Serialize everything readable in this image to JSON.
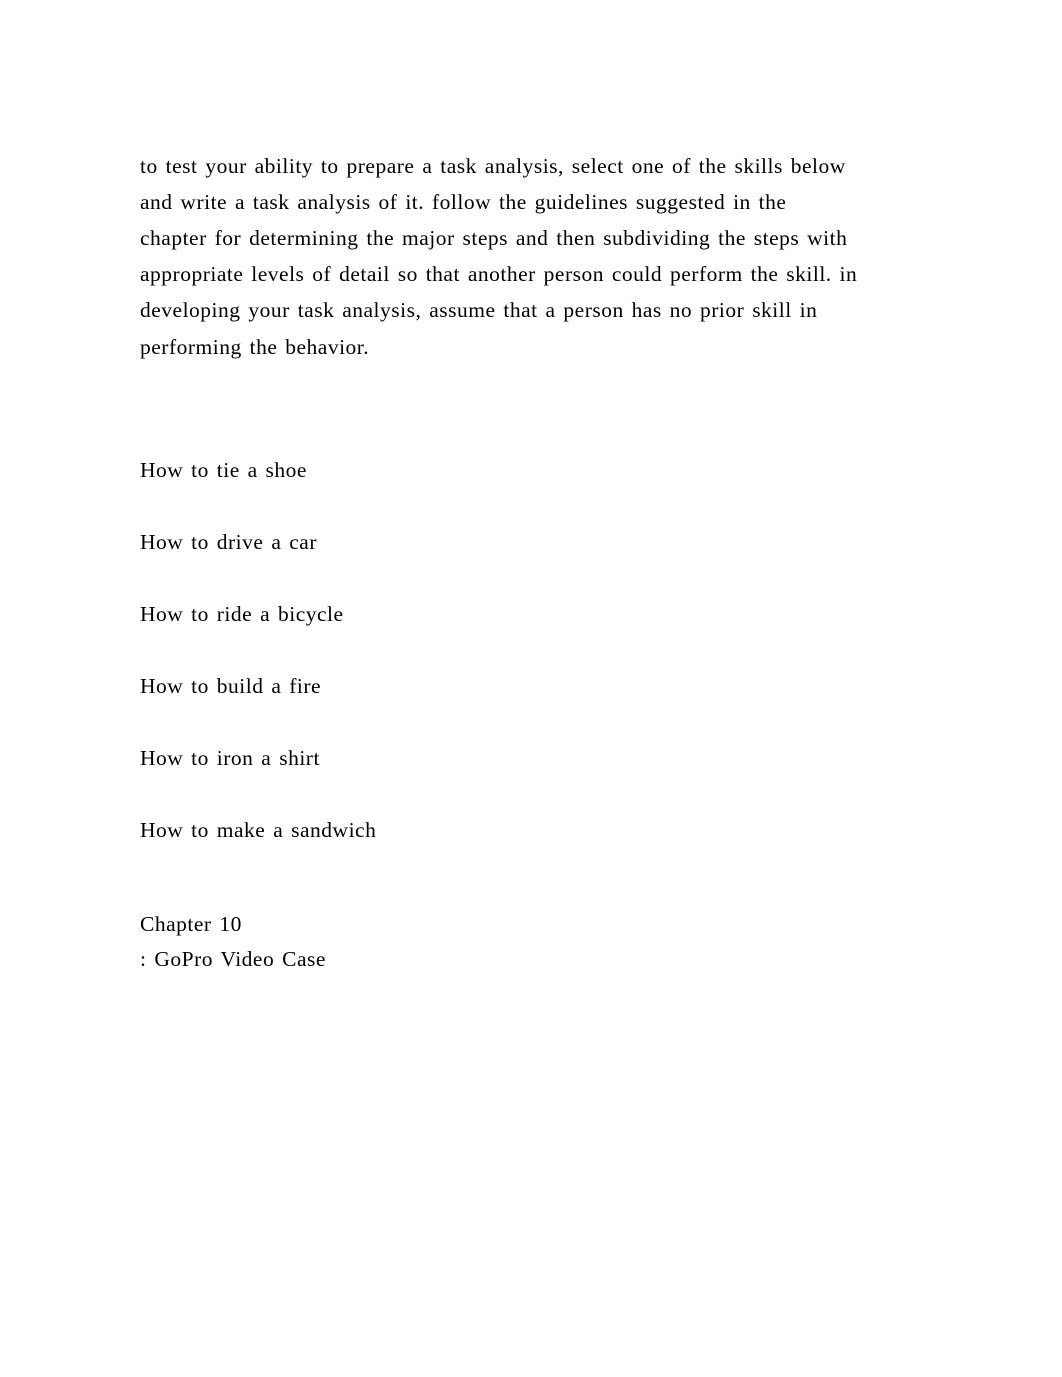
{
  "intro": "to test your ability to prepare a task analysis, select one of the skills below and write a task analysis of it. follow the guidelines suggested in the chapter for determining the major steps and then subdividing the steps with appropriate levels of detail so that another person could perform the skill. in developing your task analysis, assume that a person has no prior skill in performing the behavior.",
  "skills": [
    "How to tie a shoe",
    "How to drive a car",
    "How to ride a bicycle",
    "How to build a fire",
    "How to iron a shirt",
    "How to make a sandwich"
  ],
  "chapter": {
    "title": "Chapter 10",
    "subtitle": ": GoPro Video Case"
  }
}
